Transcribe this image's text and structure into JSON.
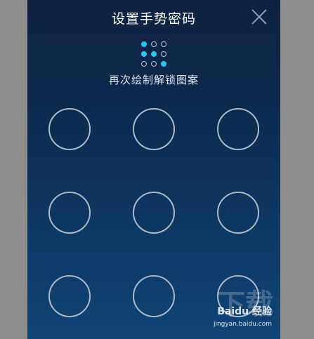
{
  "header": {
    "title": "设置手势密码",
    "close_icon": "close-icon"
  },
  "pattern_preview": {
    "rows": 3,
    "cols": 3,
    "active": [
      true,
      false,
      false,
      true,
      true,
      false,
      false,
      false,
      true
    ],
    "active_color": "#22c6f2",
    "inactive_color": "#b8c4d3"
  },
  "instruction": "再次绘制解锁图案",
  "lock_grid": {
    "rows": 3,
    "cols": 3,
    "ring_color": "#aab9c9"
  },
  "watermark": {
    "brand": "Baidu 经验",
    "url": "jingyan.baidu.com",
    "large_text": "下载"
  },
  "colors": {
    "background_outer": "#8d8d8d",
    "screen_top": "#0f2240",
    "screen_bottom": "#0f4475"
  }
}
